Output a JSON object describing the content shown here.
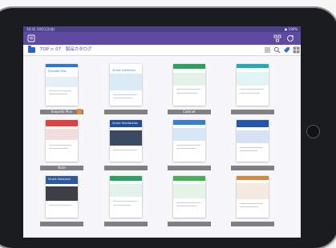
{
  "status_bar": {
    "left": "10:41 10月1日(金)",
    "right": "● 100%"
  },
  "app_bar": {
    "menu_icon": "hamburger-list-icon",
    "share_icon": "network-share-icon",
    "sync_icon": "sync-icon"
  },
  "path_bar": {
    "breadcrumb": "TOP > 07　製品カタログ",
    "folder_icon": "folder-icon",
    "tools": [
      "list-view-icon",
      "search-icon",
      "tag-icon",
      "grid-view-icon"
    ]
  },
  "catalogs": [
    {
      "title": "Enquete Plus",
      "caption": "Enquete Plus",
      "accent": "#2f78c8"
    },
    {
      "title": "Smart Collection",
      "caption": "",
      "accent": "#3a86c7"
    },
    {
      "title": "",
      "caption": "Cabinet",
      "accent": "#2e9f5f"
    },
    {
      "title": "",
      "caption": "",
      "accent": "#21a9b7"
    },
    {
      "title": "",
      "caption": "Note",
      "accent": "#d8453f"
    },
    {
      "title": "Smart Distribution",
      "caption": "",
      "accent": "#1f4f9a"
    },
    {
      "title": "",
      "caption": "",
      "accent": "#3b7dc8"
    },
    {
      "title": "",
      "caption": "",
      "accent": "#2456a8"
    },
    {
      "title": "Smart Solutions",
      "caption": "",
      "accent": "#2c5a9a"
    },
    {
      "title": "",
      "caption": "",
      "accent": "#2d9f67"
    },
    {
      "title": "",
      "caption": "",
      "accent": "#4bae57"
    },
    {
      "title": "",
      "caption": "",
      "accent": "#d58a3a"
    }
  ]
}
